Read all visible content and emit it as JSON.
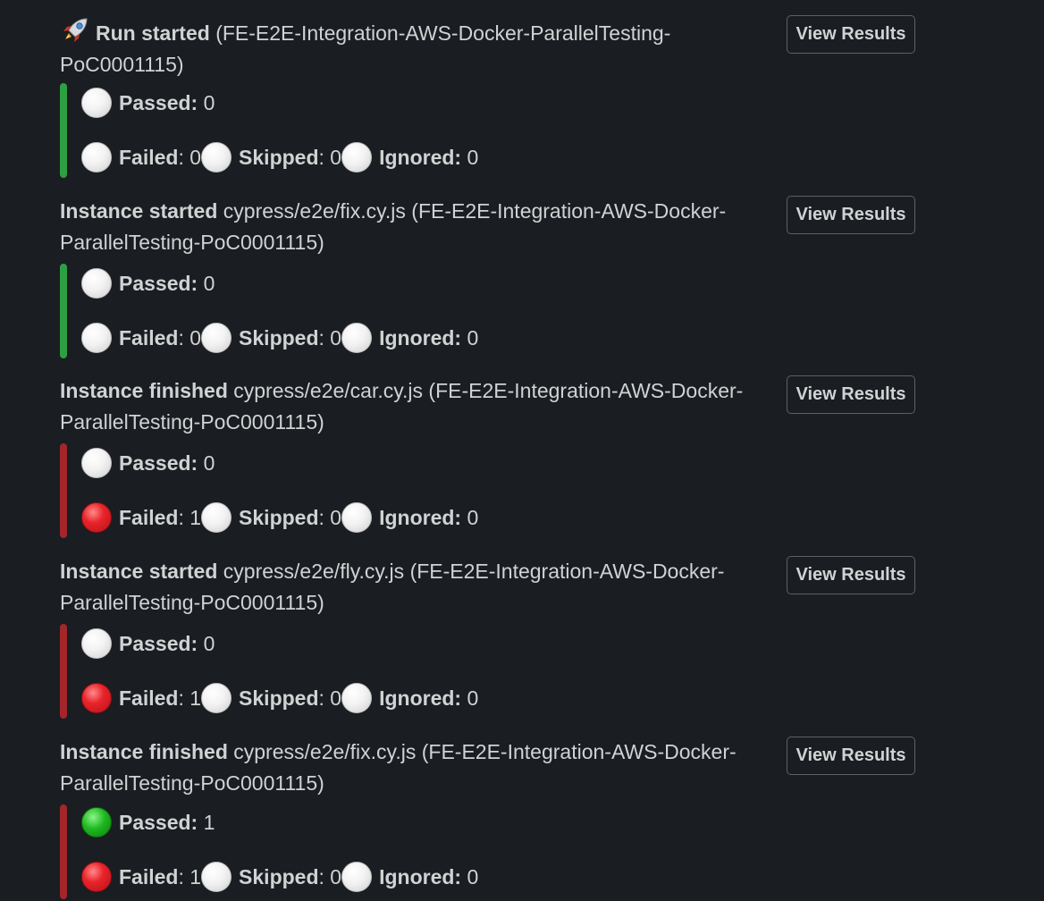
{
  "colors": {
    "green_bar": "#2ea043",
    "red_bar": "#a3262a",
    "background": "#1a1d21",
    "text": "#d1d2d3"
  },
  "messages": [
    {
      "icon": "rocket-icon",
      "event": "Run started",
      "path": "",
      "run": "(FE-E2E-Integration-AWS-Docker-ParallelTesting-PoC0001115)",
      "button": "View Results",
      "bar": "green",
      "passed_label": "Passed:",
      "passed": "0",
      "passed_dot": "white",
      "failed_label": "Failed",
      "failed": ": 0",
      "failed_dot": "white",
      "skipped_label": "Skipped",
      "skipped": ": 0",
      "ignored_label": "Ignored:",
      "ignored": "0"
    },
    {
      "icon": "",
      "event": "Instance started",
      "path": "cypress/e2e/fix.cy.js",
      "run": "(FE-E2E-Integration-AWS-Docker-ParallelTesting-PoC0001115)",
      "button": "View Results",
      "bar": "green",
      "passed_label": "Passed:",
      "passed": "0",
      "passed_dot": "white",
      "failed_label": "Failed",
      "failed": ": 0",
      "failed_dot": "white",
      "skipped_label": "Skipped",
      "skipped": ": 0",
      "ignored_label": "Ignored:",
      "ignored": "0"
    },
    {
      "icon": "",
      "event": "Instance finished",
      "path": "cypress/e2e/car.cy.js",
      "run": "(FE-E2E-Integration-AWS-Docker-ParallelTesting-PoC0001115)",
      "button": "View Results",
      "bar": "red",
      "passed_label": "Passed:",
      "passed": "0",
      "passed_dot": "white",
      "failed_label": "Failed",
      "failed": ": 1",
      "failed_dot": "red",
      "skipped_label": "Skipped",
      "skipped": ": 0",
      "ignored_label": "Ignored:",
      "ignored": "0"
    },
    {
      "icon": "",
      "event": "Instance started",
      "path": "cypress/e2e/fly.cy.js",
      "run": "(FE-E2E-Integration-AWS-Docker-ParallelTesting-PoC0001115)",
      "button": "View Results",
      "bar": "red",
      "passed_label": "Passed:",
      "passed": "0",
      "passed_dot": "white",
      "failed_label": "Failed",
      "failed": ": 1",
      "failed_dot": "red",
      "skipped_label": "Skipped",
      "skipped": ": 0",
      "ignored_label": "Ignored:",
      "ignored": "0"
    },
    {
      "icon": "",
      "event": "Instance finished",
      "path": "cypress/e2e/fix.cy.js",
      "run": "(FE-E2E-Integration-AWS-Docker-ParallelTesting-PoC0001115)",
      "button": "View Results",
      "bar": "red",
      "passed_label": "Passed:",
      "passed": "1",
      "passed_dot": "green",
      "failed_label": "Failed",
      "failed": ": 1",
      "failed_dot": "red",
      "skipped_label": "Skipped",
      "skipped": ": 0",
      "ignored_label": "Ignored:",
      "ignored": "0"
    }
  ]
}
